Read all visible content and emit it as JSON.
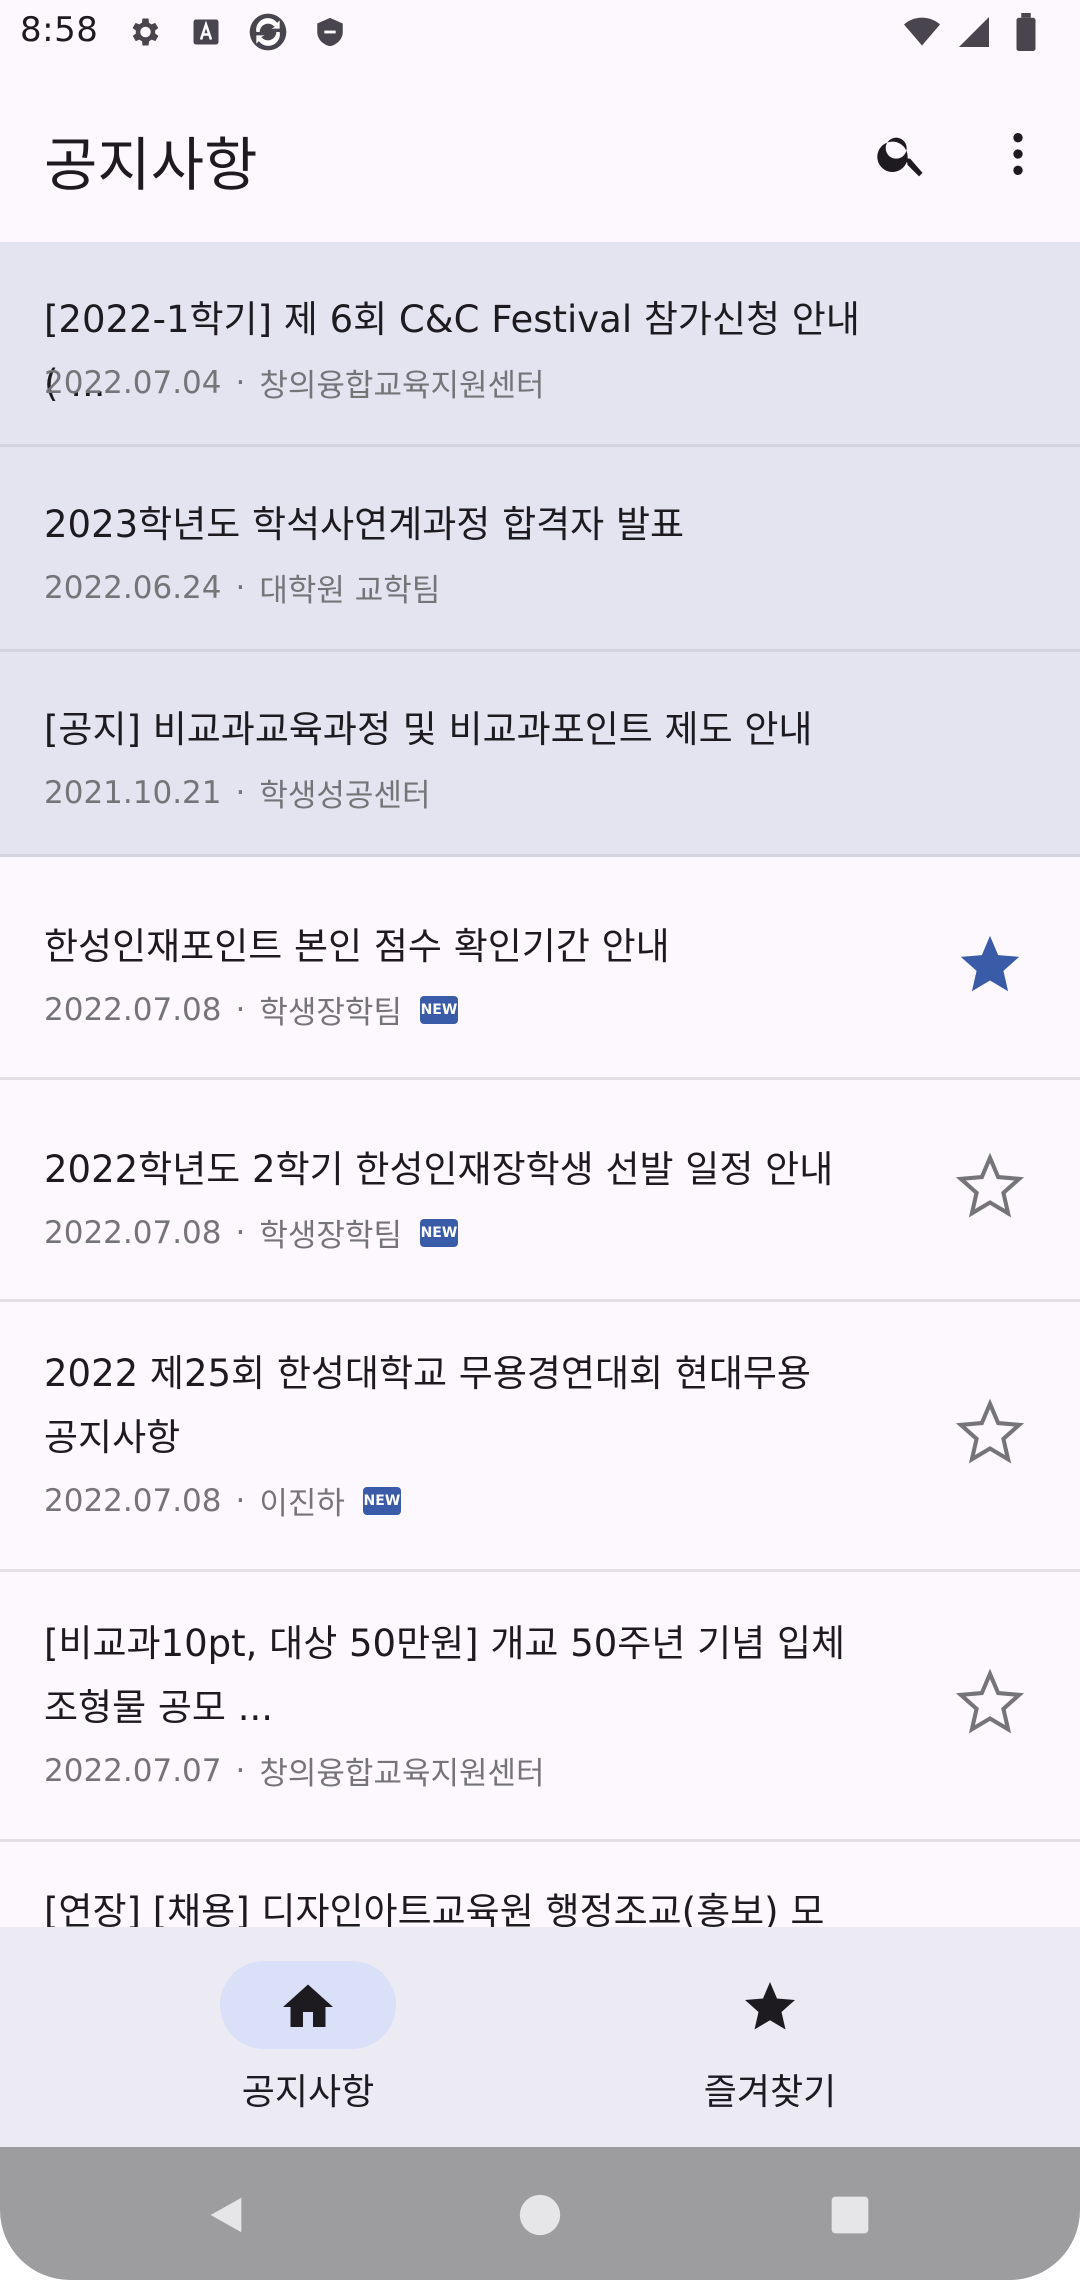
{
  "status_bar": {
    "time": "8:58",
    "left_icons": [
      "gear-icon",
      "a-icon",
      "sync-icon",
      "shield-icon"
    ],
    "right_icons": [
      "wifi-icon",
      "signal-icon",
      "battery-icon"
    ]
  },
  "app_bar": {
    "title": "공지사항",
    "actions": [
      "search-icon",
      "more-vert-icon"
    ]
  },
  "notices": [
    {
      "title": "[2022-1학기] 제 6회 C&C Festival 참가신청 안내 ( ...",
      "date": "2022.07.04",
      "dept": "창의융합교육지원센터",
      "pinned": true,
      "is_new": false
    },
    {
      "title": "2023학년도 학석사연계과정 합격자 발표",
      "date": "2022.06.24",
      "dept": "대학원 교학팀",
      "pinned": true,
      "is_new": false
    },
    {
      "title": "[공지] 비교과교육과정 및 비교과포인트 제도 안내",
      "date": "2021.10.21",
      "dept": "학생성공센터",
      "pinned": true,
      "is_new": false
    },
    {
      "title": "한성인재포인트 본인 점수 확인기간 안내",
      "date": "2022.07.08",
      "dept": "학생장학팀",
      "pinned": false,
      "is_new": true,
      "starred": true
    },
    {
      "title": "2022학년도 2학기 한성인재장학생 선발 일정 안내",
      "date": "2022.07.08",
      "dept": "학생장학팀",
      "pinned": false,
      "is_new": true,
      "starred": false
    },
    {
      "title": "2022 제25회 한성대학교 무용경연대회 현대무용\n공지사항",
      "date": "2022.07.08",
      "dept": "이진하",
      "pinned": false,
      "is_new": true,
      "starred": false
    },
    {
      "title": "[비교과10pt, 대상 50만원] 개교 50주년 기념 입체\n조형물 공모 ...",
      "date": "2022.07.07",
      "dept": "창의융합교육지원센터",
      "pinned": false,
      "is_new": false,
      "starred": false
    },
    {
      "title": "[연장] [채용] 디자인아트교육원 행정조교(홍보) 모",
      "date": "",
      "dept": "",
      "pinned": false,
      "is_new": false,
      "starred": false
    }
  ],
  "meta_separator": "·",
  "new_badge": "NEW",
  "bottom_nav": {
    "items": [
      {
        "label": "공지사항",
        "icon": "home-icon",
        "selected": true
      },
      {
        "label": "즐겨찾기",
        "icon": "star-icon",
        "selected": false
      }
    ]
  },
  "colors": {
    "accent": "#3a5ba8",
    "pinned_bg": "#e4e4f0",
    "nav_bg": "#ecebf4",
    "nav_pill": "#d9e0f8"
  }
}
